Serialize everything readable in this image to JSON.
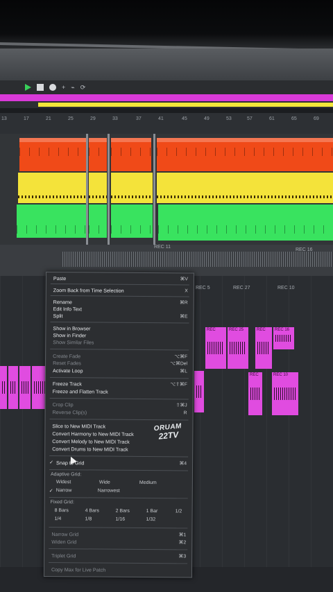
{
  "ruler": [
    "13",
    "17",
    "21",
    "25",
    "29",
    "33",
    "37",
    "41",
    "45",
    "49",
    "53",
    "57",
    "61",
    "65",
    "69"
  ],
  "lane_labels": {
    "rec_main": "REC 11",
    "rec_right": "REC 16",
    "rec_a": "REC 5",
    "rec_b": "REC 27",
    "rec_c": "REC 10"
  },
  "pink_clips": [
    "REC",
    "REC 25",
    "REC",
    "REC 16",
    "REC",
    "REC 10"
  ],
  "menu": {
    "paste": {
      "label": "Paste",
      "key": "⌘V"
    },
    "zoom_back": {
      "label": "Zoom Back from Time Selection",
      "key": "X"
    },
    "rename": {
      "label": "Rename",
      "key": "⌘R"
    },
    "edit_info": {
      "label": "Edit Info Text",
      "key": ""
    },
    "split": {
      "label": "Split",
      "key": "⌘E"
    },
    "show_browser": {
      "label": "Show in Browser",
      "key": ""
    },
    "show_finder": {
      "label": "Show in Finder",
      "key": ""
    },
    "show_similar": {
      "label": "Show Similar Files",
      "key": ""
    },
    "create_fade": {
      "label": "Create Fade",
      "key": "⌥⌘F"
    },
    "reset_fades": {
      "label": "Reset Fades",
      "key": "⌥⌘Del"
    },
    "activate_loop": {
      "label": "Activate Loop",
      "key": "⌘L"
    },
    "freeze": {
      "label": "Freeze Track",
      "key": "⌥⇧⌘F"
    },
    "freeze_flatten": {
      "label": "Freeze and Flatten Track",
      "key": ""
    },
    "crop": {
      "label": "Crop Clip",
      "key": "⇧⌘J"
    },
    "reverse": {
      "label": "Reverse Clip(s)",
      "key": "R"
    },
    "slice": {
      "label": "Slice to New MIDI Track",
      "key": ""
    },
    "conv_harmony": {
      "label": "Convert Harmony to New MIDI Track",
      "key": ""
    },
    "conv_melody": {
      "label": "Convert Melody to New MIDI Track",
      "key": ""
    },
    "conv_drums": {
      "label": "Convert Drums to New MIDI Track",
      "key": ""
    },
    "snap": {
      "label": "Snap to Grid",
      "key": "⌘4",
      "check": "✓"
    },
    "adaptive": "Adaptive Grid:",
    "widest": "Widest",
    "wide": "Wide",
    "medium": "Medium",
    "narrow": "Narrow",
    "narrowest": "Narrowest",
    "narrow_check": "✓",
    "fixed": "Fixed Grid:",
    "bars": [
      "8 Bars",
      "4 Bars",
      "2 Bars",
      "1 Bar",
      "1/2"
    ],
    "fracs": [
      "1/4",
      "1/8",
      "1/16",
      "1/32"
    ],
    "narrow_grid": {
      "label": "Narrow Grid",
      "key": "⌘1"
    },
    "widen_grid": {
      "label": "Widen Grid",
      "key": "⌘2"
    },
    "triplet": {
      "label": "Triplet Grid",
      "key": "⌘3"
    },
    "copy_max": {
      "label": "Copy Max for Live Patch",
      "key": ""
    }
  },
  "watermark": {
    "line1": "ORUAM",
    "line2": "22TV"
  },
  "colors": {
    "accent_green": "#39e35f",
    "clip_red": "#f04a18",
    "clip_yellow": "#f4e33a",
    "clip_pink": "#e04ce0",
    "magenta": "#d93ad8"
  }
}
